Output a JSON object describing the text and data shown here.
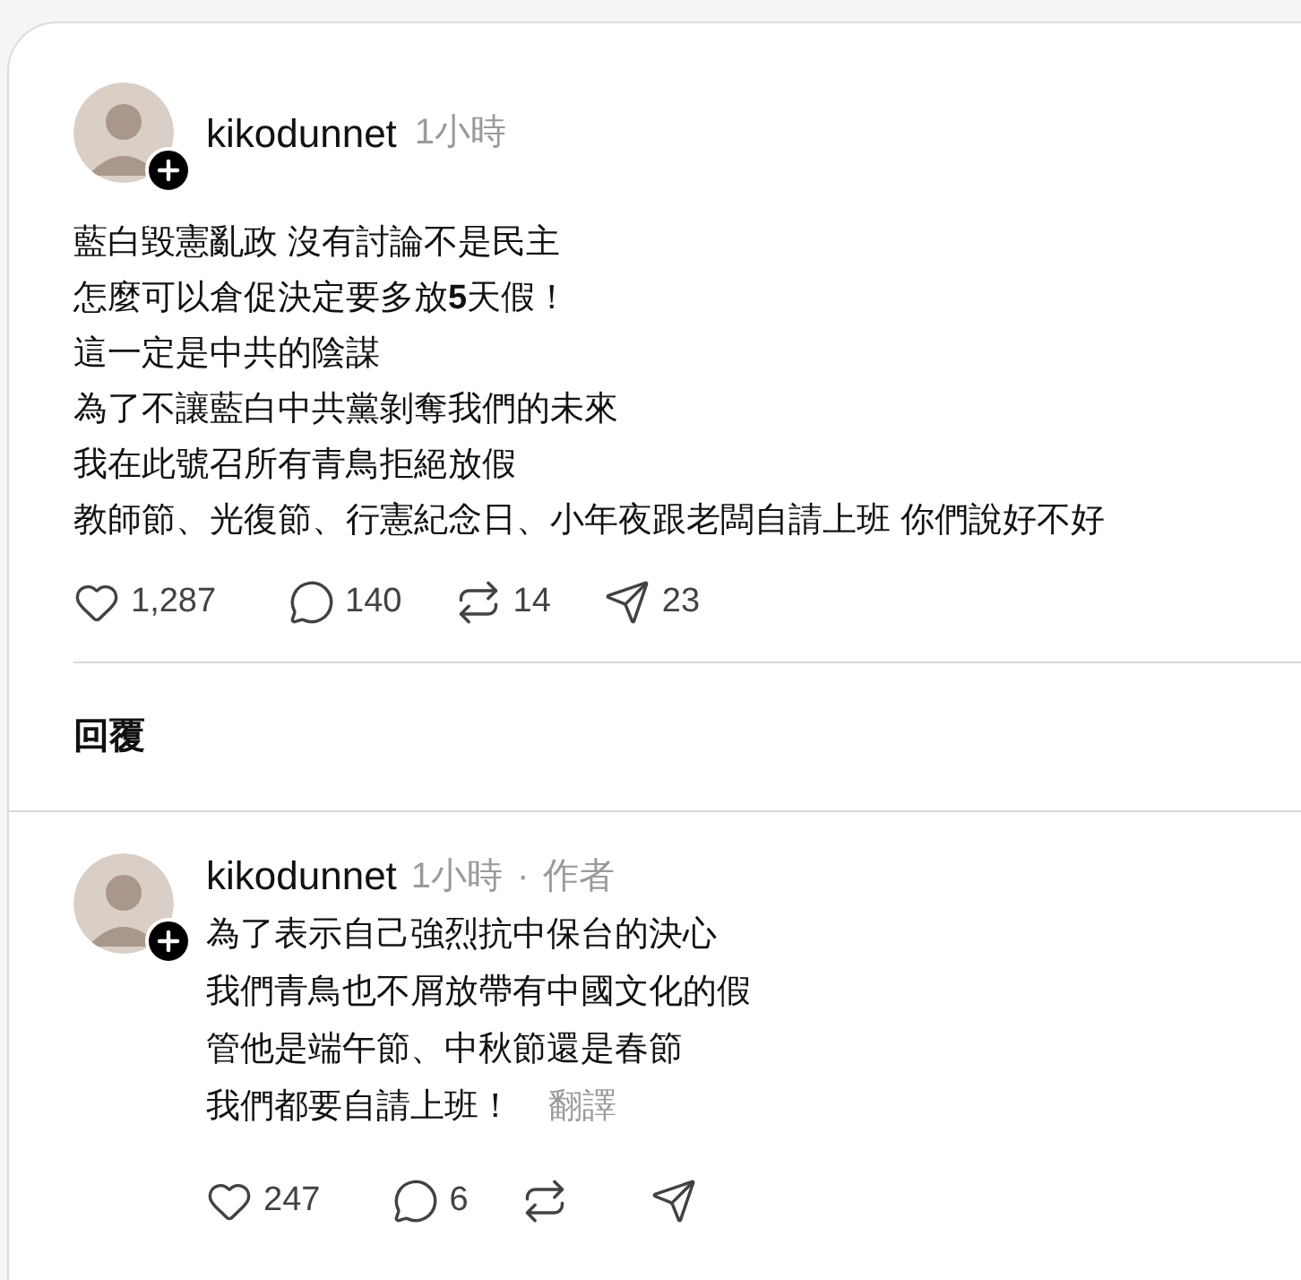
{
  "post": {
    "author": "kikodunnet",
    "time": "1小時",
    "lines": [
      "藍白毀憲亂政 沒有討論不是民主",
      "怎麼可以倉促決定要多放**5**天假！",
      "這一定是中共的陰謀",
      "為了不讓藍白中共黨剝奪我們的未來",
      "我在此號召所有青鳥拒絕放假",
      "教師節、光復節、行憲紀念日、小年夜跟老闆自請上班 你們說好不好"
    ],
    "actions": [
      {
        "kind": "like",
        "count": "1,287"
      },
      {
        "kind": "comment",
        "count": "140"
      },
      {
        "kind": "repost",
        "count": "14"
      },
      {
        "kind": "share",
        "count": "23"
      }
    ]
  },
  "replies_heading": "回覆",
  "reply": {
    "author": "kikodunnet",
    "time": "1小時",
    "separator": "·",
    "badge": "作者",
    "lines": [
      "為了表示自己強烈抗中保台的決心",
      "我們青鳥也不屑放帶有中國文化的假",
      "管他是端午節、中秋節還是春節",
      "我們都要自請上班！"
    ],
    "translate": "翻譯",
    "actions": [
      {
        "kind": "like",
        "count": "247"
      },
      {
        "kind": "comment",
        "count": "6"
      },
      {
        "kind": "repost"
      },
      {
        "kind": "share"
      }
    ]
  }
}
